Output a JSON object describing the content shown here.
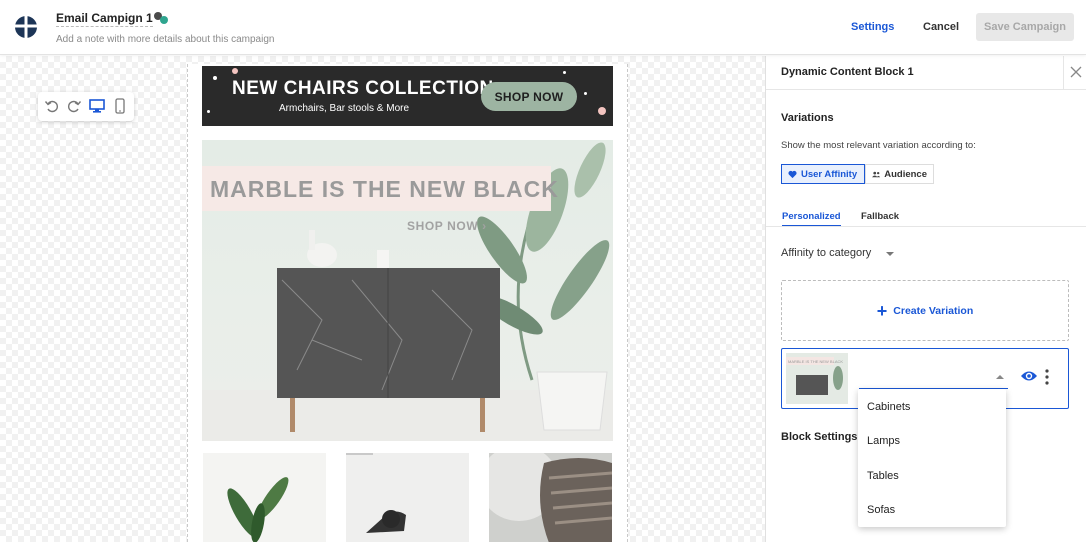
{
  "header": {
    "campaign_title": "Email Campign 1",
    "campaign_note": "Add a note with more details about this campaign",
    "settings_label": "Settings",
    "cancel_label": "Cancel",
    "save_label": "Save Campaign"
  },
  "toolbar": {
    "icons": [
      "undo-icon",
      "redo-icon",
      "desktop-icon",
      "mobile-icon"
    ]
  },
  "email": {
    "banner_title": "NEW CHAIRS COLLECTION",
    "banner_subtitle": "Armchairs, Bar stools & More",
    "banner_button": "SHOP NOW",
    "hero_headline": "MARBLE IS THE NEW BLACK",
    "hero_shop": "SHOP NOW ›"
  },
  "panel": {
    "title": "Dynamic Content Block 1",
    "variations_heading": "Variations",
    "variations_desc": "Show the most relevant variation according to:",
    "segments": [
      {
        "label": "User Affinity",
        "icon": "heart-icon",
        "active": true
      },
      {
        "label": "Audience",
        "icon": "people-icon",
        "active": false
      }
    ],
    "tabs": [
      {
        "label": "Personalized",
        "active": true
      },
      {
        "label": "Fallback",
        "active": false
      }
    ],
    "affinity_select": "Affinity to category",
    "create_variation": "Create Variation",
    "variation_thumb_text": "MARBLE IS THE NEW BLACK",
    "block_settings": "Block Settings ("
  },
  "dropdown": {
    "options": [
      "Cabinets",
      "Lamps",
      "Tables",
      "Sofas"
    ]
  },
  "colors": {
    "accent": "#1a57d6",
    "banner_bg": "#2a2a2a",
    "shop_pill": "#9db4a2"
  }
}
